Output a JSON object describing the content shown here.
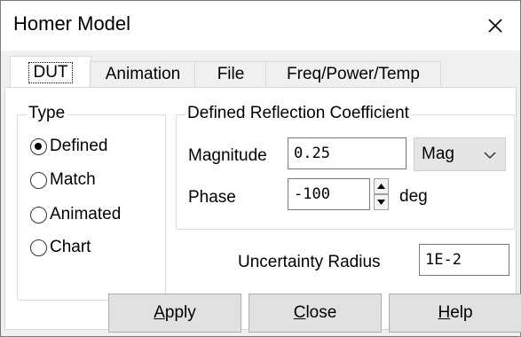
{
  "window": {
    "title": "Homer Model",
    "close_icon": "close-icon"
  },
  "tabs": [
    {
      "label": "DUT",
      "active": true
    },
    {
      "label": "Animation",
      "active": false
    },
    {
      "label": "File",
      "active": false
    },
    {
      "label": "Freq/Power/Temp",
      "active": false
    }
  ],
  "type_group": {
    "legend": "Type",
    "options": [
      {
        "label": "Defined",
        "checked": true
      },
      {
        "label": "Match",
        "checked": false
      },
      {
        "label": "Animated",
        "checked": false
      },
      {
        "label": "Chart",
        "checked": false
      }
    ]
  },
  "reflection_group": {
    "legend": "Defined Reflection Coefficient",
    "magnitude_label": "Magnitude",
    "magnitude_value": "0.25",
    "magnitude_unit": "Mag",
    "phase_label": "Phase",
    "phase_value": "-100",
    "phase_unit": "deg"
  },
  "uncertainty": {
    "label": "Uncertainty Radius",
    "value": "1E-2"
  },
  "buttons": {
    "apply": {
      "first": "A",
      "rest": "pply"
    },
    "close": {
      "first": "C",
      "rest": "lose"
    },
    "help": {
      "first": "H",
      "rest": "elp"
    }
  }
}
